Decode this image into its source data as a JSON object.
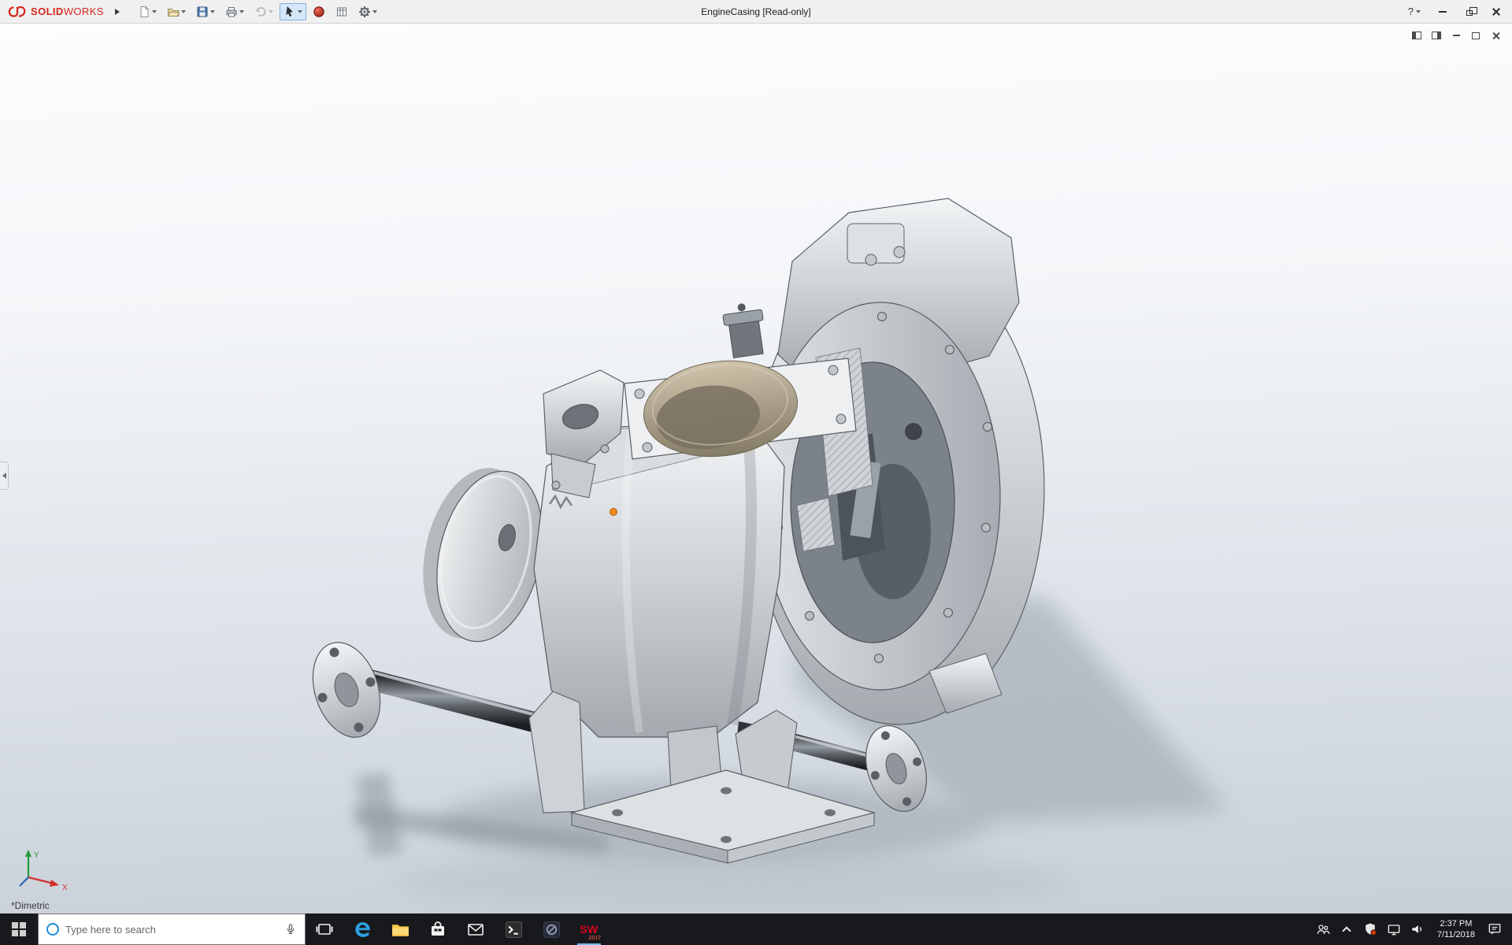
{
  "titlebar": {
    "brand": {
      "solid": "SOLID",
      "works": "WORKS"
    },
    "title": "EngineCasing [Read-only]",
    "help": "?"
  },
  "viewport": {
    "orientation": "*Dimetric",
    "triad": {
      "x": "X",
      "y": "Y"
    }
  },
  "taskbar": {
    "search_placeholder": "Type here to search",
    "solidworks_label": "SW",
    "solidworks_year": "2017",
    "clock": {
      "time": "2:37 PM",
      "date": "7/11/2018"
    }
  }
}
